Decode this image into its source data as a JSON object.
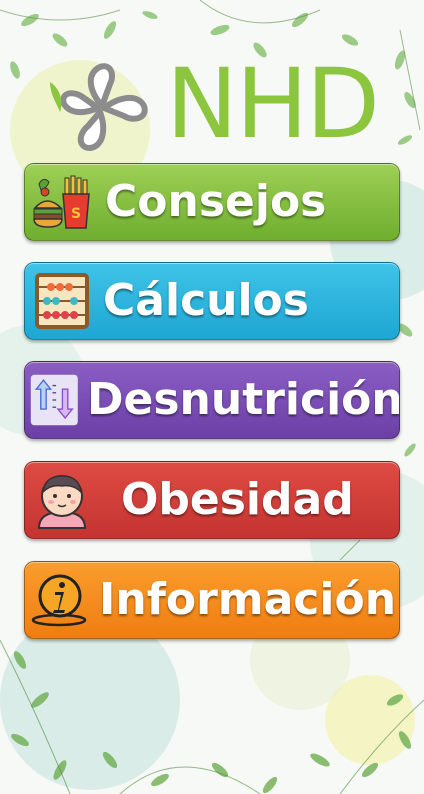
{
  "brand": {
    "name": "NHD",
    "logo_icon": "petal-logo-icon"
  },
  "menu": {
    "items": [
      {
        "label": "Consejos",
        "icon": "fast-food-icon",
        "color": "#7cbc3a"
      },
      {
        "label": "Cálculos",
        "icon": "abacus-icon",
        "color": "#27b2dc"
      },
      {
        "label": "Desnutrición",
        "icon": "weight-arrows-icon",
        "color": "#7a4fb6"
      },
      {
        "label": "Obesidad",
        "icon": "child-face-icon",
        "color": "#d13f3a"
      },
      {
        "label": "Información",
        "icon": "info-icon",
        "color": "#f58b1e"
      }
    ]
  },
  "colors": {
    "brand_green": "#8cc63f",
    "logo_gray": "#8c8c8c"
  }
}
